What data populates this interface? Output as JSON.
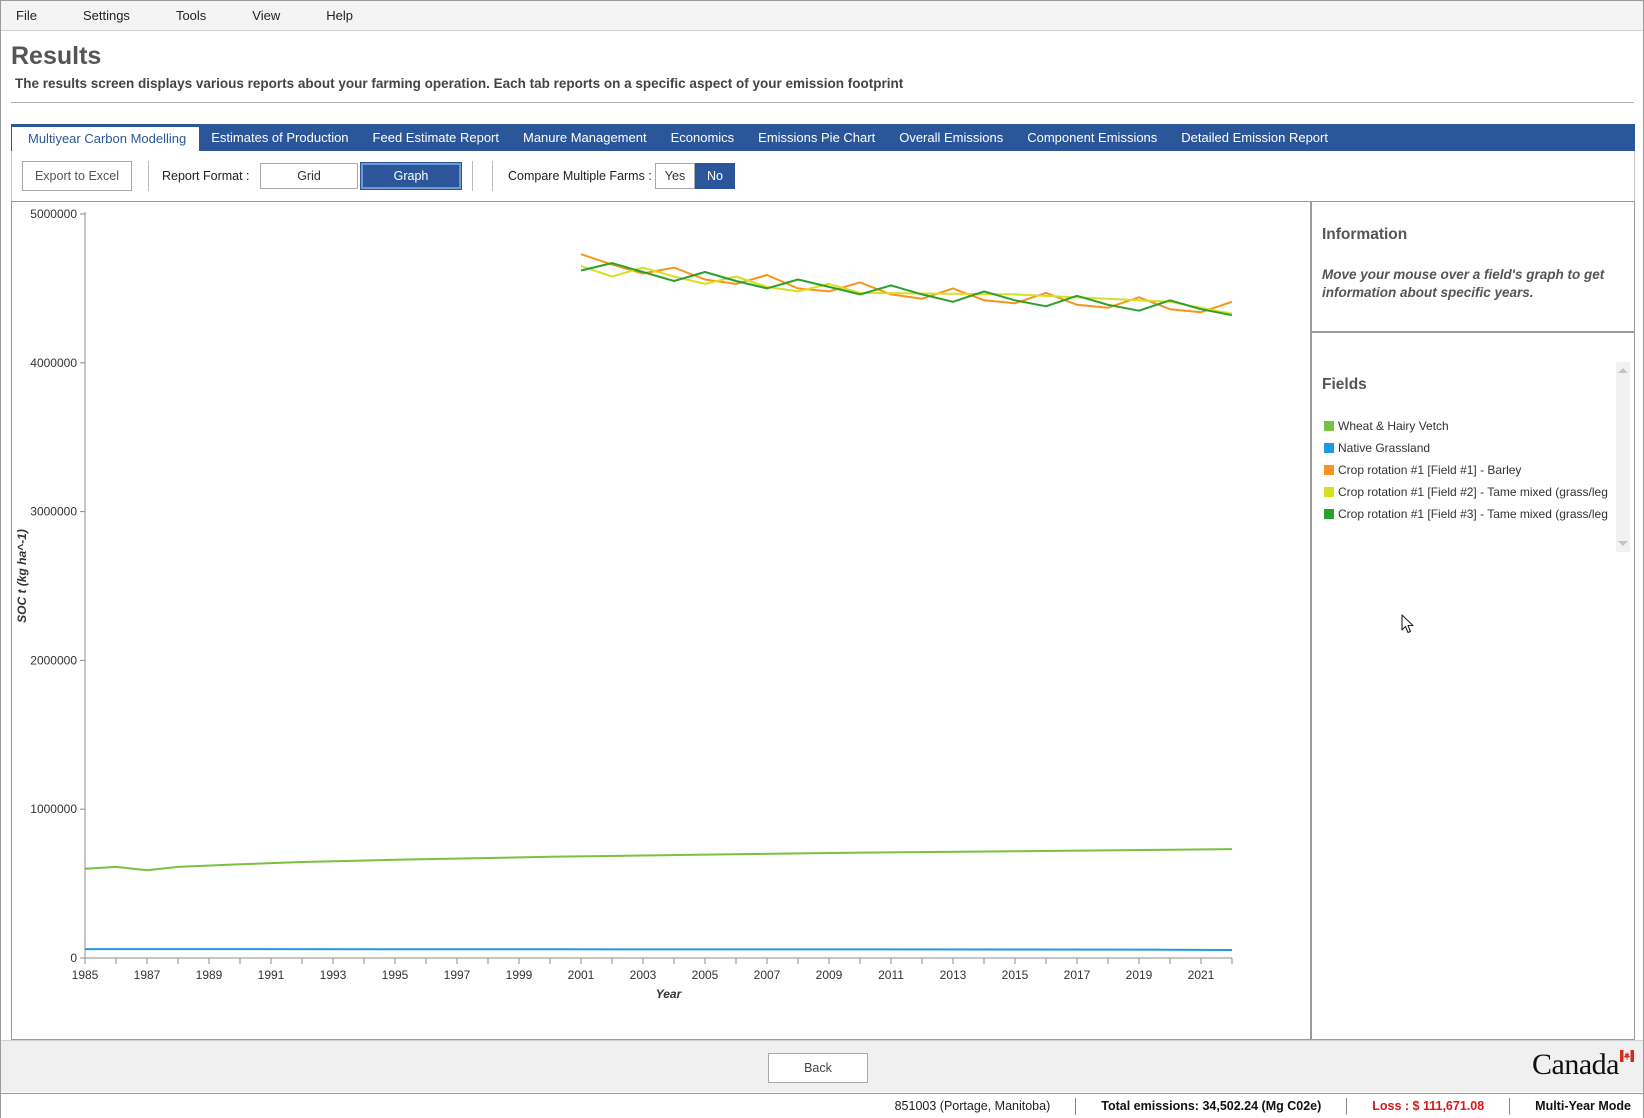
{
  "menu": [
    "File",
    "Settings",
    "Tools",
    "View",
    "Help"
  ],
  "header": {
    "title": "Results",
    "subtitle": "The results screen displays various reports about your farming operation. Each tab reports on a specific aspect of your emission footprint"
  },
  "tabs": [
    {
      "label": "Multiyear Carbon Modelling",
      "active": true
    },
    {
      "label": "Estimates of Production",
      "active": false
    },
    {
      "label": "Feed Estimate Report",
      "active": false
    },
    {
      "label": "Manure Management",
      "active": false
    },
    {
      "label": "Economics",
      "active": false
    },
    {
      "label": "Emissions Pie Chart",
      "active": false
    },
    {
      "label": "Overall Emissions",
      "active": false
    },
    {
      "label": "Component Emissions",
      "active": false
    },
    {
      "label": "Detailed Emission Report",
      "active": false
    }
  ],
  "toolbar": {
    "export_label": "Export to Excel",
    "report_format_label": "Report Format :",
    "grid_label": "Grid",
    "graph_label": "Graph",
    "selected_format": "Graph",
    "compare_label": "Compare Multiple Farms :",
    "yes_label": "Yes",
    "no_label": "No",
    "compare_selected": "No"
  },
  "info": {
    "title": "Information",
    "text": "Move your mouse over a field's graph to get information about specific years."
  },
  "fields": {
    "title": "Fields",
    "items": [
      {
        "label": "Wheat & Hairy Vetch",
        "color": "#7ac143"
      },
      {
        "label": "Native Grassland",
        "color": "#1e9be0"
      },
      {
        "label": "Crop rotation #1 [Field #1] - Barley",
        "color": "#f7941d"
      },
      {
        "label": "Crop rotation #1 [Field #2] - Tame mixed (grass/leg",
        "color": "#d7df23"
      },
      {
        "label": "Crop rotation #1 [Field #3] - Tame mixed (grass/leg",
        "color": "#2ca02c"
      }
    ]
  },
  "chart_data": {
    "type": "line",
    "xlabel": "Year",
    "ylabel": "SOC t (kg ha^-1)",
    "xlim": [
      1985,
      2022
    ],
    "ylim": [
      0,
      5000000
    ],
    "x_ticks": [
      1985,
      1987,
      1989,
      1991,
      1993,
      1995,
      1997,
      1999,
      2001,
      2003,
      2005,
      2007,
      2009,
      2011,
      2013,
      2015,
      2017,
      2019,
      2021
    ],
    "y_ticks": [
      0,
      1000000,
      2000000,
      3000000,
      4000000,
      5000000
    ],
    "grid": false,
    "legend": "side-panel",
    "series": [
      {
        "name": "Wheat & Hairy Vetch",
        "color": "#7ac143",
        "x": [
          1985,
          1986,
          1987,
          1988,
          1990,
          1992,
          1995,
          2000,
          2005,
          2010,
          2015,
          2020,
          2022
        ],
        "y": [
          600000,
          612000,
          590000,
          612000,
          630000,
          645000,
          660000,
          680000,
          695000,
          708000,
          718000,
          728000,
          732000
        ]
      },
      {
        "name": "Native Grassland",
        "color": "#1e9be0",
        "x": [
          1985,
          1990,
          1995,
          2000,
          2005,
          2010,
          2015,
          2020,
          2022
        ],
        "y": [
          60000,
          59500,
          59000,
          58500,
          58000,
          57500,
          57000,
          56000,
          54000
        ]
      },
      {
        "name": "Crop rotation #1 [Field #1] - Barley",
        "color": "#f7941d",
        "x": [
          2001,
          2002,
          2003,
          2004,
          2005,
          2006,
          2007,
          2008,
          2009,
          2010,
          2011,
          2012,
          2013,
          2014,
          2015,
          2016,
          2017,
          2018,
          2019,
          2020,
          2021,
          2022
        ],
        "y": [
          4730000,
          4660000,
          4600000,
          4640000,
          4560000,
          4530000,
          4590000,
          4500000,
          4480000,
          4540000,
          4460000,
          4430000,
          4500000,
          4420000,
          4400000,
          4470000,
          4390000,
          4370000,
          4440000,
          4360000,
          4340000,
          4410000
        ]
      },
      {
        "name": "Crop rotation #1 [Field #2] - Tame mixed (grass/leg",
        "color": "#d7df23",
        "x": [
          2001,
          2002,
          2003,
          2004,
          2005,
          2006,
          2007,
          2008,
          2009,
          2010,
          2015,
          2020,
          2022
        ],
        "y": [
          4650000,
          4580000,
          4640000,
          4580000,
          4530000,
          4580000,
          4510000,
          4480000,
          4530000,
          4470000,
          4460000,
          4410000,
          4330000
        ]
      },
      {
        "name": "Crop rotation #1 [Field #3] - Tame mixed (grass/leg",
        "color": "#2ca02c",
        "x": [
          2001,
          2002,
          2003,
          2004,
          2005,
          2006,
          2007,
          2008,
          2009,
          2010,
          2011,
          2012,
          2013,
          2014,
          2015,
          2016,
          2017,
          2018,
          2019,
          2020,
          2021,
          2022
        ],
        "y": [
          4620000,
          4670000,
          4610000,
          4550000,
          4610000,
          4550000,
          4500000,
          4560000,
          4510000,
          4460000,
          4520000,
          4460000,
          4410000,
          4480000,
          4420000,
          4380000,
          4450000,
          4390000,
          4350000,
          4420000,
          4360000,
          4320000
        ]
      }
    ]
  },
  "footer": {
    "back_label": "Back",
    "wordmark": "Canada"
  },
  "status": {
    "location": "851003 (Portage, Manitoba)",
    "emissions": "Total emissions: 34,502.24 (Mg C02e)",
    "loss": "Loss :  $ 111,671.08",
    "mode": "Multi-Year Mode"
  }
}
